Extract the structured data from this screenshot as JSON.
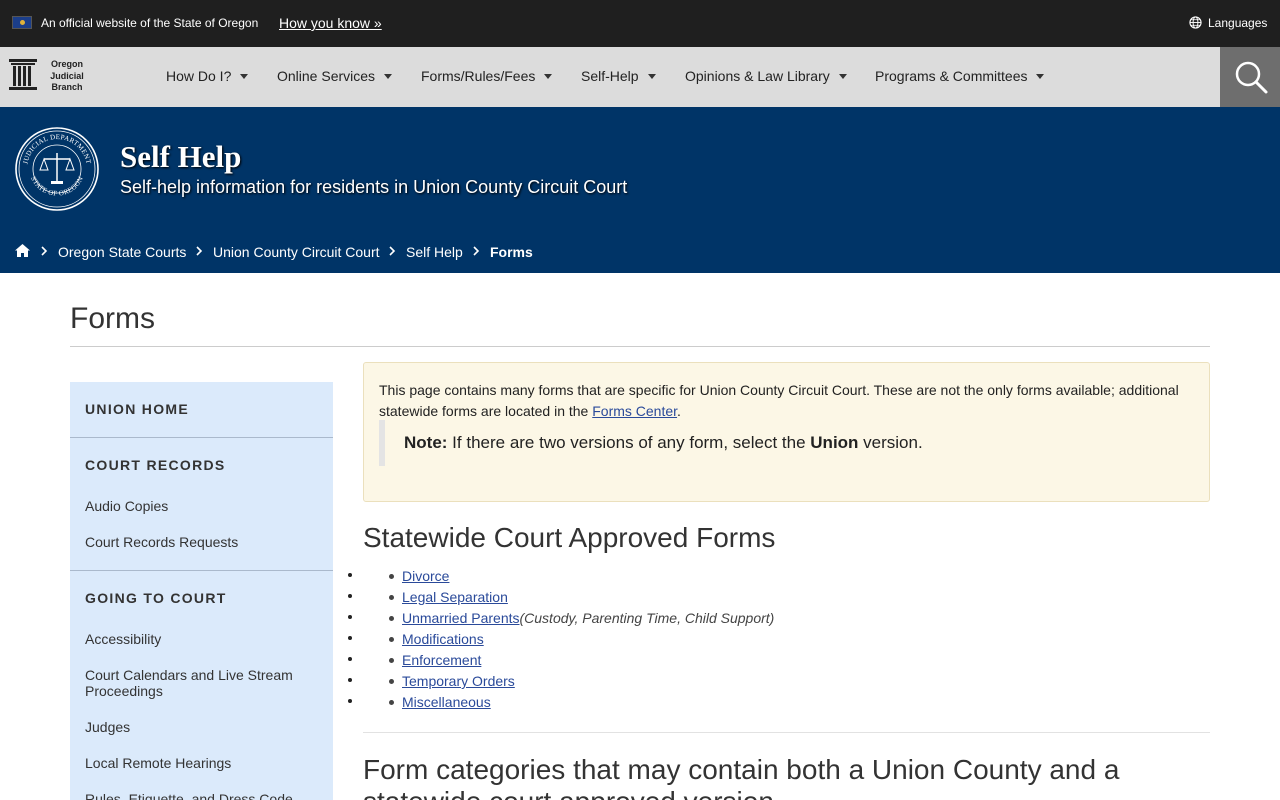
{
  "official_bar": {
    "text": "An official website of the State of Oregon",
    "how_link": "How you know »",
    "languages": "Languages"
  },
  "logo": {
    "line1": "Oregon",
    "line2": "Judicial",
    "line3": "Branch"
  },
  "nav": {
    "items": [
      {
        "label": "How Do I?"
      },
      {
        "label": "Online Services"
      },
      {
        "label": "Forms/Rules/Fees"
      },
      {
        "label": "Self-Help"
      },
      {
        "label": "Opinions & Law Library"
      },
      {
        "label": "Programs & Committees"
      }
    ]
  },
  "hero": {
    "seal_top": "JUDICIAL DEPARTMENT",
    "seal_bottom": "STATE OF OREGON",
    "title": "Self Help",
    "subtitle": "Self-help information for residents in Union County Circuit Court"
  },
  "breadcrumb": {
    "items": [
      {
        "label": "Oregon State Courts"
      },
      {
        "label": "Union County Circuit Court"
      },
      {
        "label": "Self Help"
      },
      {
        "label": "Forms"
      }
    ]
  },
  "page": {
    "title": "Forms"
  },
  "sidebar": {
    "sections": [
      {
        "heading": "UNION HOME",
        "links": []
      },
      {
        "heading": "COURT RECORDS",
        "links": [
          "Audio Copies",
          "Court Records Requests"
        ]
      },
      {
        "heading": "GOING TO COURT",
        "links": [
          "Accessibility",
          "Court Calendars and Live Stream Proceedings",
          "Judges",
          "Local Remote Hearings",
          "Rules, Etiquette, and Dress Code"
        ]
      }
    ]
  },
  "notice": {
    "text_before_link": "This page contains many forms that are specific for Union County Circuit Court.  These are not the only forms available; additional statewide forms are located in the ",
    "link": "Forms Center",
    "text_after_link": ".",
    "note_label": "Note:",
    "note_text_before": " If there are two versions of any form, select the ",
    "note_bold": "Union",
    "note_text_after": " version."
  },
  "statewide": {
    "title": "Statewide Court Approved Forms",
    "items": [
      {
        "label": "Divorce",
        "note": ""
      },
      {
        "label": "Legal Separation",
        "note": ""
      },
      {
        "label": "Unmarried Parents",
        "note": "(Custody, Parenting Time, Child Support)"
      },
      {
        "label": "Modifications",
        "note": ""
      },
      {
        "label": "Enforcement",
        "note": ""
      },
      {
        "label": "Temporary Orders",
        "note": ""
      },
      {
        "label": "Miscellaneous",
        "note": ""
      }
    ]
  },
  "categories": {
    "title_line1": "Form categories that may contain both a Union County and a",
    "title_line2": "statewide court approved version"
  },
  "colors": {
    "official_bar": "#1f1f1f",
    "nav_bg": "#dcdcdc",
    "search_bg": "#6e6e6e",
    "hero_bg": "#003467",
    "sidebar_bg": "#dbeafb",
    "notice_bg": "#fcf7e6",
    "link": "#2a4a9a"
  },
  "icons": {
    "flag": "oregon-flag-icon",
    "languages": "globe-icon",
    "search": "search-icon",
    "home": "home-icon",
    "breadcrumb_separator": "chevron-right-icon",
    "nav_dropdown": "caret-down-icon"
  }
}
